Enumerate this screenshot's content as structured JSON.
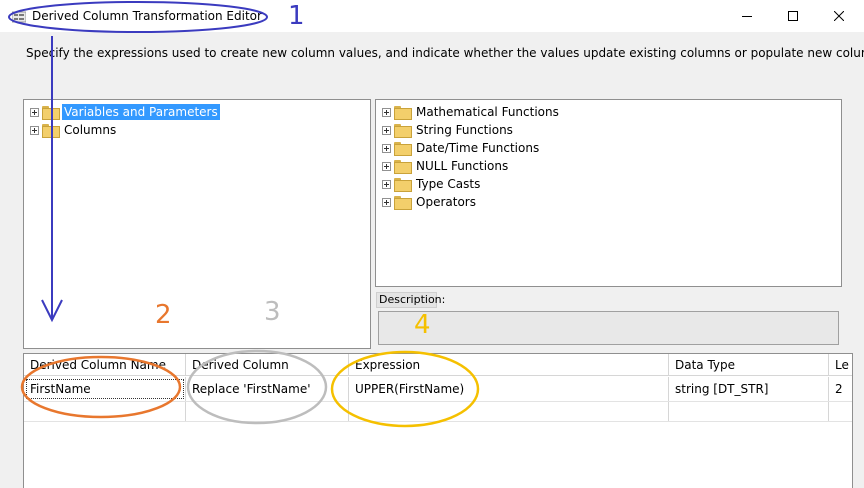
{
  "window": {
    "title": "Derived Column Transformation Editor",
    "app_icon": "editor-app-icon",
    "minimize_icon": "minimize-icon",
    "maximize_icon": "maximize-icon",
    "close_icon": "close-icon"
  },
  "intro_text": "Specify the expressions used to create new column values, and indicate whether the values update existing columns or populate new columns.",
  "left_tree": {
    "items": [
      {
        "label": "Variables and Parameters",
        "selected": true
      },
      {
        "label": "Columns",
        "selected": false
      }
    ]
  },
  "right_tree": {
    "items": [
      {
        "label": "Mathematical Functions"
      },
      {
        "label": "String Functions"
      },
      {
        "label": "Date/Time Functions"
      },
      {
        "label": "NULL Functions"
      },
      {
        "label": "Type Casts"
      },
      {
        "label": "Operators"
      }
    ]
  },
  "description": {
    "label": "Description:",
    "value": ""
  },
  "grid": {
    "columns": [
      "Derived Column Name",
      "Derived Column",
      "Expression",
      "Data Type",
      "Le"
    ],
    "rows": [
      [
        "FirstName",
        "Replace 'FirstName'",
        "UPPER(FirstName)",
        "string [DT_STR]",
        "2"
      ]
    ]
  },
  "annotations": {
    "labels": [
      "1",
      "2",
      "3",
      "4"
    ],
    "colors": {
      "blue": "#3b3bbf",
      "orange": "#e8772e",
      "gray": "#bdbdbd",
      "yellow": "#f5c000"
    }
  }
}
